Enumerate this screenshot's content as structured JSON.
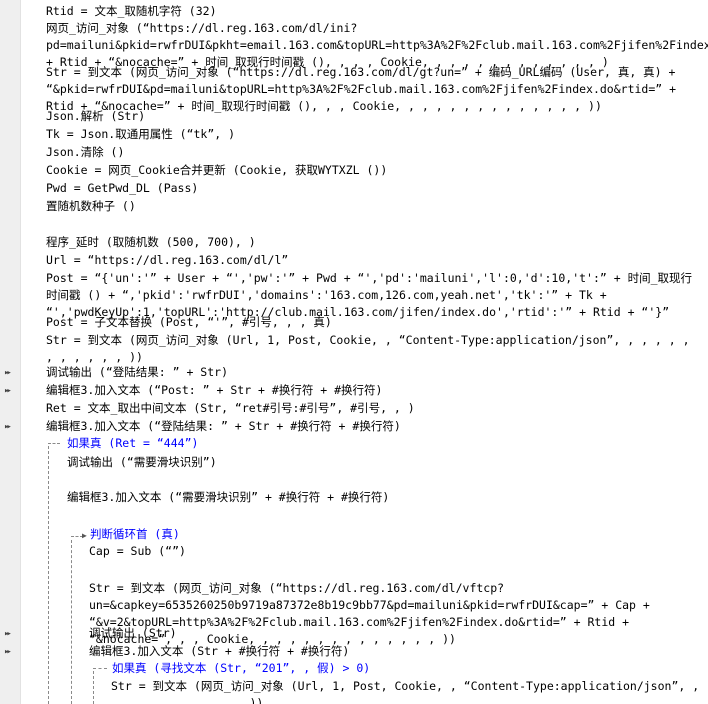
{
  "lines": [
    {
      "id": "l01",
      "text": "Rtid = 文本_取随机字符 (32)"
    },
    {
      "id": "l02",
      "text": "网页_访问_对象 (“https://dl.reg.163.com/dl/ini?pd=mailuni&pkid=rwfrDUI&pkht=email.163.com&topURL=http%3A%2F%2Fclub.mail.163.com%2Fjifen%2Findex.do&rtid=” + Rtid + “&nocache=” + 时间_取现行时间戳 (), , , , Cookie, , , , , , , , , , , , , )"
    },
    {
      "id": "l03",
      "text": "Str = 到文本 (网页_访问_对象 (“https://dl.reg.163.com/dl/gt?un=” + 编码_URL编码 (User, 真, 真) + “&pkid=rwfrDUI&pd=mailuni&topURL=http%3A%2F%2Fclub.mail.163.com%2Fjifen%2Findex.do&rtid=” + Rtid + “&nocache=” + 时间_取现行时间戳 (), , , Cookie, , , , , , , , , , , , , , ))"
    },
    {
      "id": "l04",
      "text": "Json.解析 (Str)"
    },
    {
      "id": "l05",
      "text": "Tk = Json.取通用属性 (“tk”, )"
    },
    {
      "id": "l06",
      "text": "Json.清除 ()"
    },
    {
      "id": "l07",
      "text": "Cookie = 网页_Cookie合并更新 (Cookie, 获取WYTXZL ())"
    },
    {
      "id": "l08",
      "text": "Pwd = GetPwd_DL (Pass)"
    },
    {
      "id": "l09",
      "text": "置随机数种子 ()"
    },
    {
      "id": "l10",
      "text": "程序_延时 (取随机数 (500, 700), )"
    },
    {
      "id": "l11",
      "text": "Url = “https://dl.reg.163.com/dl/l”"
    },
    {
      "id": "l12",
      "text": "Post = “{'un':'” + User + “','pw':'” + Pwd + “','pd':'mailuni','l':0,'d':10,'t':” + 时间_取现行时间戳 () + “,'pkid':'rwfrDUI','domains':'163.com,126.com,yeah.net','tk':'” + Tk + “','pwdKeyUp':1,'topURL':'http://club.mail.163.com/jifen/index.do','rtid':'” + Rtid + “'}”"
    },
    {
      "id": "l13",
      "text": "Post = 子文本替换 (Post, “'”, #引号, , , 真)"
    },
    {
      "id": "l14",
      "text": "Str = 到文本 (网页_访问_对象 (Url, 1, Post, Cookie, , “Content-Type:application/json”, , , , , , , , , , , , ))"
    },
    {
      "id": "l15",
      "text": "调试输出 (“登陆结果: ” + Str)"
    },
    {
      "id": "l16",
      "text": "编辑框3.加入文本 (“Post: ” + Str + #换行符 + #换行符)"
    },
    {
      "id": "l17",
      "text": "Ret = 文本_取出中间文本 (Str, “ret#引号:#引号”, #引号, , )"
    },
    {
      "id": "l18",
      "text": "编辑框3.加入文本 (“登陆结果: ” + Str + #换行符 + #换行符)"
    },
    {
      "id": "l19",
      "text": "如果真 (Ret = “444”)"
    },
    {
      "id": "l20",
      "text": "调试输出 (“需要滑块识别”)"
    },
    {
      "id": "l21",
      "text": "编辑框3.加入文本 (“需要滑块识别” + #换行符 + #换行符)"
    },
    {
      "id": "l22",
      "text": "判断循环首 (真)"
    },
    {
      "id": "l23",
      "text": "Cap = Sub (“”)"
    },
    {
      "id": "l24",
      "text": "Str = 到文本 (网页_访问_对象 (“https://dl.reg.163.com/dl/vftcp?un=&capkey=6535260250b9719a87372e8b19c9bb77&pd=mailuni&pkid=rwfrDUI&cap=” + Cap + “&v=2&topURL=http%3A%2F%2Fclub.mail.163.com%2Fjifen%2Findex.do&rtid=” + Rtid + “&nocache=”, , , Cookie, , , , , , , , , , , , , , ))"
    },
    {
      "id": "l25",
      "text": "调试输出 (Str)"
    },
    {
      "id": "l26",
      "text": "编辑框3.加入文本 (Str + #换行符 + #换行符)"
    },
    {
      "id": "l27",
      "text": "如果真 (寻找文本 (Str, “201”, , 假) > 0)"
    },
    {
      "id": "l28",
      "text": "Str = 到文本 (网页_访问_对象 (Url, 1, Post, Cookie, , “Content-Type:application/json”, , , , , , , , , , , , ))"
    }
  ]
}
